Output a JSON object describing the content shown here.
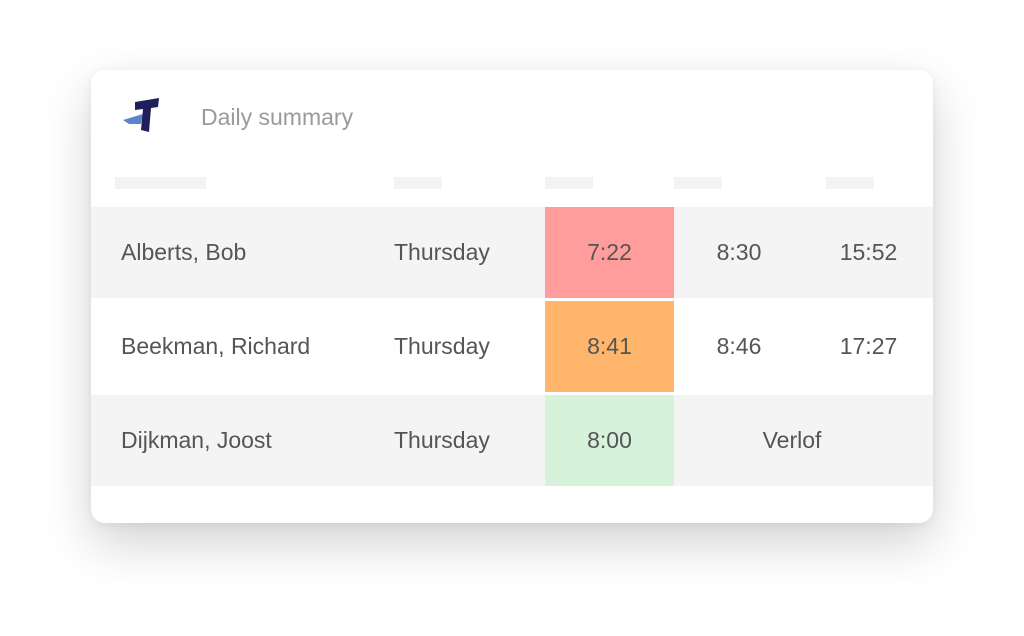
{
  "header": {
    "title": "Daily summary",
    "logo": "timetracking-t-logo-icon"
  },
  "colors": {
    "under": "#ff9d9d",
    "over": "#ffb56b",
    "ok": "#d7f2da",
    "row_shade": "#f4f4f4",
    "logo_dark": "#1f1f5c",
    "logo_light": "#5b86cc"
  },
  "rows": [
    {
      "name": "Alberts, Bob",
      "day": "Thursday",
      "hours": "7:22",
      "status": "under",
      "start": "8:30",
      "end": "15:52"
    },
    {
      "name": "Beekman, Richard",
      "day": "Thursday",
      "hours": "8:41",
      "status": "over",
      "start": "8:46",
      "end": "17:27"
    },
    {
      "name": "Dijkman, Joost",
      "day": "Thursday",
      "hours": "8:00",
      "status": "ok",
      "note": "Verlof"
    }
  ]
}
